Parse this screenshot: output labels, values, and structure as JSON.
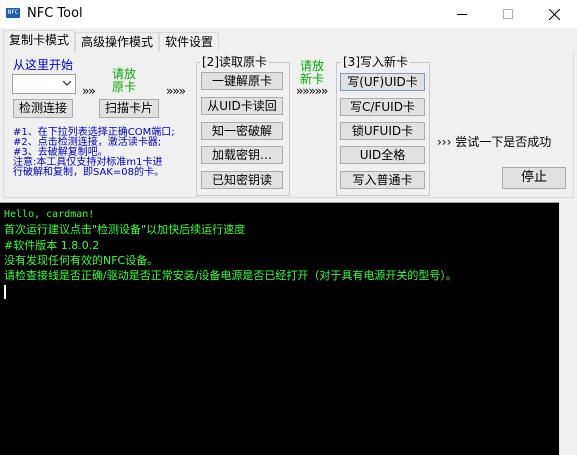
{
  "window": {
    "icon_text": "NFC",
    "title": "NFC Tool",
    "icons": {
      "minimize": "minimize-icon",
      "maximize": "maximize-icon",
      "close": "close-icon"
    }
  },
  "tabs": [
    {
      "label": "复制卡模式",
      "active": true
    },
    {
      "label": "高级操作模式",
      "active": false
    },
    {
      "label": "软件设置",
      "active": false
    }
  ],
  "start": {
    "heading": "从这里开始",
    "device_select_value": "",
    "detect_button": "检测连接",
    "scan_button": "扫描卡片",
    "place_label": [
      "请放",
      "原卡"
    ],
    "arrow1": "»",
    "arrow2": "»»",
    "arrow3": "»»»"
  },
  "read_group": {
    "title": "[2]读取原卡",
    "buttons": [
      "一键解原卡",
      "从UID卡读回",
      "知一密破解",
      "加载密钥…",
      "已知密钥读"
    ]
  },
  "new_card": {
    "place_label": [
      "请放",
      "新卡"
    ],
    "arrow": "»»»»»"
  },
  "write_group": {
    "title": "[3]写入新卡",
    "buttons": [
      "写(UF)UID卡",
      "写C/FUID卡",
      "锁UFUID卡",
      "UID全格",
      "写入普通卡"
    ]
  },
  "try_text": "››› 尝试一下是否成功",
  "stop_button": "停止",
  "instructions": [
    "#1、在下拉列表选择正确COM端口;",
    "#2、点击检测连接，激活读卡器;",
    "#3、去破解复制吧。",
    "注意:本工具仅支持对标准m1卡进",
    "行破解和复制，即SAK=08的卡。"
  ],
  "console": {
    "lines": [
      "Hello, cardman!",
      "首次运行建议点击\"检测设备\"以加快后续运行速度",
      "#软件版本 1.8.0.2",
      "没有发现任何有效的NFC设备。",
      "请检查接线是否正确/驱动是否正常安装/设备电源是否已经打开（对于具有电源开关的型号）。"
    ]
  },
  "colors": {
    "console_text": "#3cff3c",
    "blue_text": "#0000cc",
    "green_text": "#00aa00"
  }
}
